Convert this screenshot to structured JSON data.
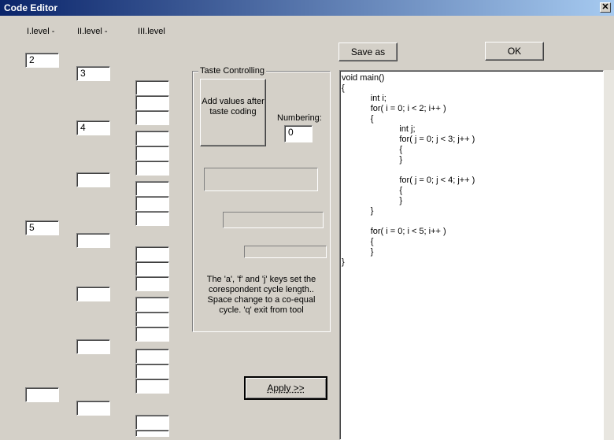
{
  "window": {
    "title": "Code Editor",
    "close_glyph": "✕"
  },
  "levels": {
    "level1": "I.level -",
    "level2": "II.level -",
    "level3": "III.level"
  },
  "level1_inputs": [
    "2",
    "5",
    ""
  ],
  "level2_inputs": [
    "3",
    "4",
    "",
    "",
    "",
    "",
    ""
  ],
  "level3_inputs": [
    "",
    "",
    "",
    "",
    "",
    "",
    "",
    "",
    "",
    "",
    "",
    "",
    "",
    "",
    "",
    "",
    "",
    "",
    "",
    "",
    "",
    "",
    ""
  ],
  "taste": {
    "group_title": "Taste Controlling",
    "add_button": "Add values after taste coding",
    "numbering_label": "Numbering:",
    "numbering_value": "0",
    "help_text": "The 'a', 'f' and 'j' keys set the corespondent cycle length.. Space change to a co-equal cycle. 'q' exit from tool"
  },
  "buttons": {
    "save_as": "Save as",
    "ok": "OK",
    "apply": "Apply >>"
  },
  "code": "void main()\n{\n\t\tint i;\n\t\tfor( i = 0; i < 2; i++ )\n\t\t{\n\t\t\t\tint j;\n\t\t\t\tfor( j = 0; j < 3; j++ )\n\t\t\t\t{\n\t\t\t\t}\n\n\t\t\t\tfor( j = 0; j < 4; j++ )\n\t\t\t\t{\n\t\t\t\t}\n\t\t}\n\n\t\tfor( i = 0; i < 5; i++ )\n\t\t{\n\t\t}\n}"
}
